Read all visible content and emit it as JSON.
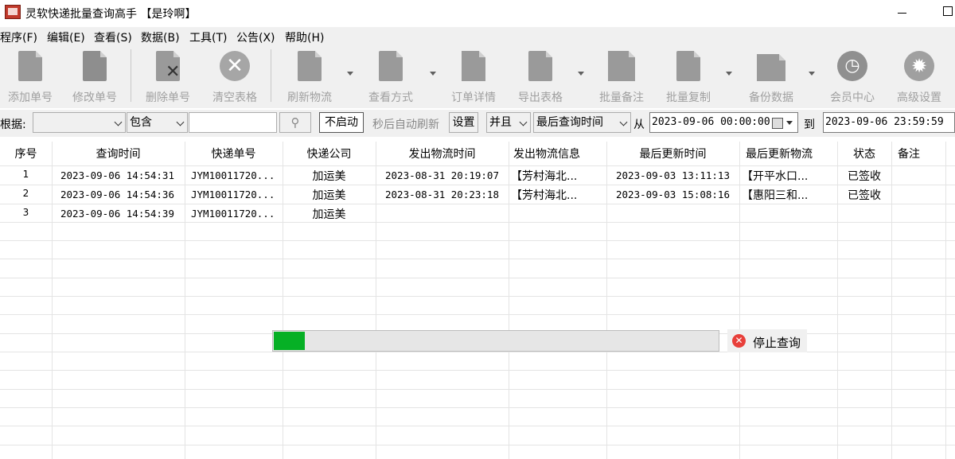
{
  "window": {
    "title": "灵软快递批量查询高手 【是玲啊】",
    "minimize": "—",
    "maximize": "☐"
  },
  "menu": [
    "程序(F)",
    "编辑(E)",
    "查看(S)",
    "数据(B)",
    "工具(T)",
    "公告(X)",
    "帮助(H)"
  ],
  "toolbar": {
    "add": "添加单号",
    "edit": "修改单号",
    "delete": "删除单号",
    "clear": "清空表格",
    "refresh": "刷新物流",
    "view_mode": "查看方式",
    "order_detail": "订单详情",
    "export": "导出表格",
    "batch_note": "批量备注",
    "batch_copy": "批量复制",
    "backup": "备份数据",
    "member": "会员中心",
    "advanced": "高级设置"
  },
  "filter": {
    "by_label": "根据:",
    "by_value": "",
    "match": "包含",
    "keyword": "",
    "search_icon": "search-icon",
    "start_btn": "不启动",
    "auto_refresh": "秒后自动刷新",
    "settings_btn": "设置",
    "logic": "并且",
    "time_field": "最后查询时间",
    "from_label": "从",
    "from_date": "2023-09-06 00:00:00",
    "to_label": "到",
    "to_date": "2023-09-06 23:59:59"
  },
  "table": {
    "columns": [
      "序号",
      "查询时间",
      "快递单号",
      "快递公司",
      "发出物流时间",
      "发出物流信息",
      "最后更新时间",
      "最后更新物流",
      "状态",
      "备注"
    ],
    "rows": [
      {
        "no": "1",
        "query_time": "2023-09-06 14:54:31",
        "tracking": "JYM10011720...",
        "company": "加运美",
        "send_time": "2023-08-31 20:19:07",
        "send_info": "【芳村海北...",
        "update_time": "2023-09-03 13:11:13",
        "update_info": "【开平水口...",
        "status": "已签收",
        "note": ""
      },
      {
        "no": "2",
        "query_time": "2023-09-06 14:54:36",
        "tracking": "JYM10011720...",
        "company": "加运美",
        "send_time": "2023-08-31 20:23:18",
        "send_info": "【芳村海北...",
        "update_time": "2023-09-03 15:08:16",
        "update_info": "【惠阳三和...",
        "status": "已签收",
        "note": ""
      },
      {
        "no": "3",
        "query_time": "2023-09-06 14:54:39",
        "tracking": "JYM10011720...",
        "company": "加运美",
        "send_time": "",
        "send_info": "",
        "update_time": "",
        "update_info": "",
        "status": "",
        "note": ""
      }
    ]
  },
  "progress": {
    "fraction": 0.07,
    "color": "#06b025",
    "stop_label": "停止查询"
  }
}
